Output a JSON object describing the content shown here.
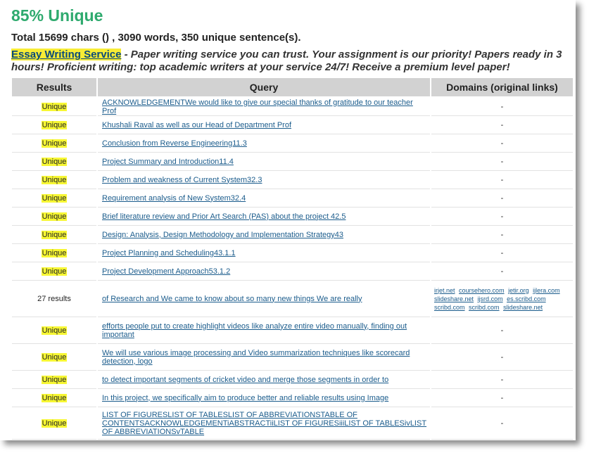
{
  "header": {
    "score": "85% Unique",
    "stats": "Total 15699 chars () , 3090 words, 350 unique sentence(s)."
  },
  "promo": {
    "link_label": "Essay Writing Service",
    "text": " - Paper writing service you can trust. Your assignment is our priority! Papers ready in 3 hours! Proficient writing: top academic writers at your service 24/7! Receive a premium level paper!"
  },
  "table": {
    "headers": [
      "Results",
      "Query",
      "Domains (original links)"
    ],
    "rows": [
      {
        "result": "Unique",
        "query": "ACKNOWLEDGEMENTWe would like to give our special thanks of gratitude to our teacher Prof",
        "domains": "-"
      },
      {
        "result": "Unique",
        "query": "Khushali Raval as well as our Head of Department Prof",
        "domains": "-"
      },
      {
        "result": "Unique",
        "query": "Conclusion from Reverse Engineering11.3",
        "domains": "-"
      },
      {
        "result": "Unique",
        "query": "Project Summary and Introduction11.4",
        "domains": "-"
      },
      {
        "result": "Unique",
        "query": "Problem and weakness of Current System32.3",
        "domains": "-"
      },
      {
        "result": "Unique",
        "query": "Requirement analysis of New System32.4",
        "domains": "-"
      },
      {
        "result": "Unique",
        "query": "Brief literature review and Prior Art Search (PAS) about the project 42.5",
        "domains": "-"
      },
      {
        "result": "Unique",
        "query": "Design: Analysis, Design Methodology and Implementation Strategy43",
        "domains": "-"
      },
      {
        "result": "Unique",
        "query": "Project Planning and Scheduling43.1.1",
        "domains": "-"
      },
      {
        "result": "Unique",
        "query": "Project Development Approach53.1.2",
        "domains": "-"
      },
      {
        "result": "27 results",
        "query": "of Research and We came to know about so many new things We are really",
        "domains_list": [
          "irjet.net",
          "coursehero.com",
          "jetir.org",
          "ijlera.com",
          "slideshare.net",
          "ijsrd.com",
          "es.scribd.com",
          "scribd.com",
          "scribd.com",
          "slideshare.net"
        ]
      },
      {
        "result": "Unique",
        "query": "efforts people put to create highlight videos like analyze entire video manually, finding out important",
        "domains": "-"
      },
      {
        "result": "Unique",
        "query": "We will use various image processing and Video summarization techniques like scorecard detection, logo",
        "domains": "-"
      },
      {
        "result": "Unique",
        "query": "to detect important segments of cricket video and merge those segments in order to",
        "domains": "-"
      },
      {
        "result": "Unique",
        "query": "In this project, we specifically aim to produce better and reliable results using Image",
        "domains": "-"
      },
      {
        "result": "Unique",
        "query": "LIST OF FIGURESLIST OF TABLESLIST OF ABBREVIATIONSTABLE OF CONTENTSACKNOWLEDGEMENTiABSTRACTiiLIST OF FIGURESiiiLIST OF TABLESivLIST OF ABBREVIATIONSvTABLE",
        "domains": "-"
      }
    ]
  },
  "colors": {
    "score_green": "#2eaa6e",
    "highlight_yellow": "#f7f733",
    "link_blue": "#1b5c8c",
    "header_gray": "#d2d2d2"
  }
}
